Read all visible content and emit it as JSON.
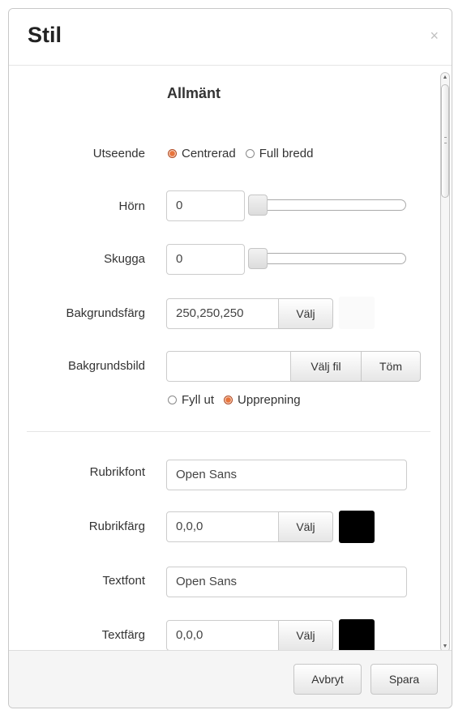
{
  "dialog": {
    "title": "Stil",
    "close_glyph": "×"
  },
  "section": {
    "title": "Allmänt"
  },
  "appearance": {
    "label": "Utseende",
    "options": [
      "Centrerad",
      "Full bredd"
    ],
    "selected": "Centrerad"
  },
  "corners": {
    "label": "Hörn",
    "value": "0",
    "slider_level": 0
  },
  "shadow": {
    "label": "Skugga",
    "value": "0",
    "slider_level": 0
  },
  "background_color": {
    "label": "Bakgrundsfärg",
    "value": "250,250,250",
    "button": "Välj",
    "swatch_color": "#fafafa"
  },
  "background_image": {
    "label": "Bakgrundsbild",
    "value": "",
    "choose_button": "Välj fil",
    "clear_button": "Töm",
    "options": [
      "Fyll ut",
      "Upprepning"
    ],
    "selected": "Upprepning"
  },
  "heading_font": {
    "label": "Rubrikfont",
    "value": "Open Sans"
  },
  "heading_color": {
    "label": "Rubrikfärg",
    "value": "0,0,0",
    "button": "Välj",
    "swatch_color": "#000000"
  },
  "text_font": {
    "label": "Textfont",
    "value": "Open Sans"
  },
  "text_color": {
    "label": "Textfärg",
    "value": "0,0,0",
    "button": "Välj",
    "swatch_color": "#000000"
  },
  "footer": {
    "cancel": "Avbryt",
    "save": "Spara"
  },
  "colors": {
    "radio_checked": "#e8743c"
  }
}
